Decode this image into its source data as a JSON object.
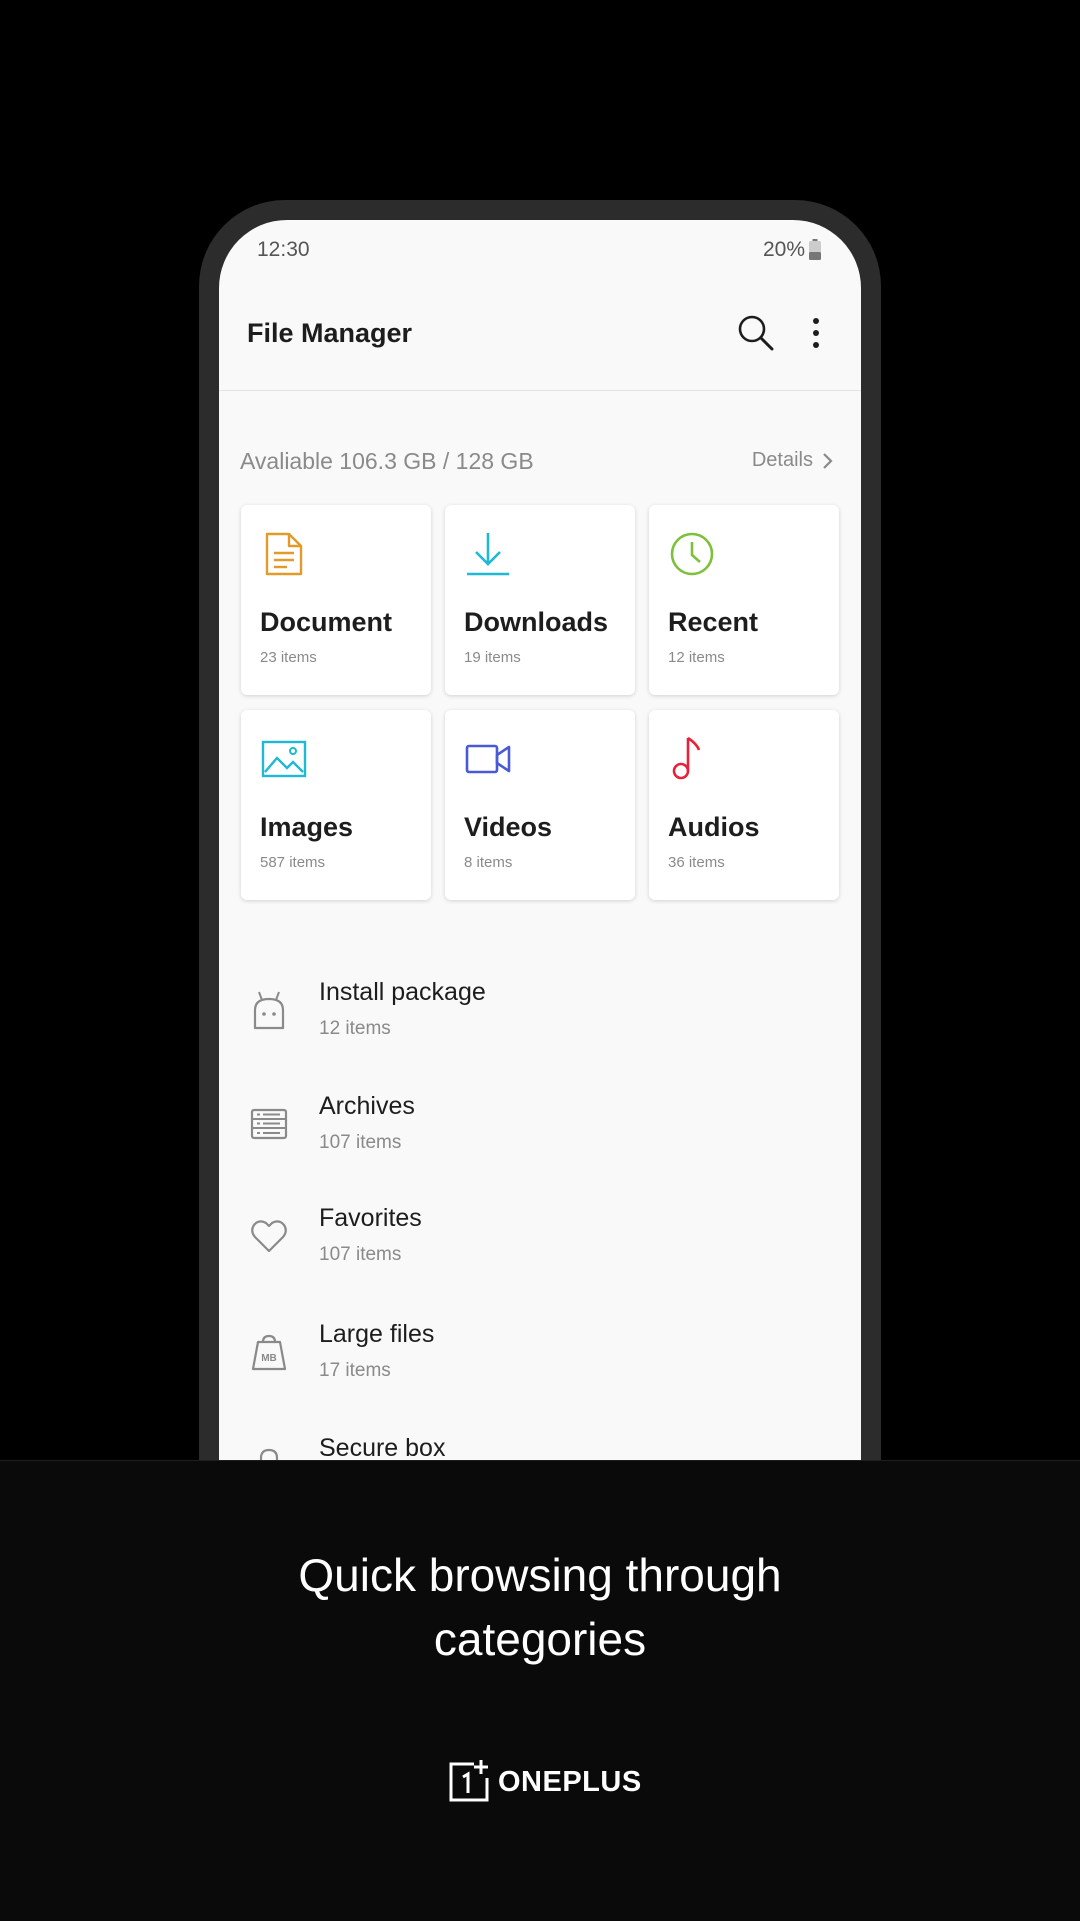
{
  "status_bar": {
    "time": "12:30",
    "battery": "20%"
  },
  "app_bar": {
    "title": "File Manager"
  },
  "storage": {
    "text": "Avaliable 106.3 GB / 128 GB",
    "details_label": "Details"
  },
  "categories": [
    {
      "name": "Document",
      "count": "23 items",
      "icon": "document-icon",
      "color": "#e29a2a"
    },
    {
      "name": "Downloads",
      "count": "19 items",
      "icon": "download-icon",
      "color": "#1fb8d5"
    },
    {
      "name": "Recent",
      "count": "12 items",
      "icon": "clock-icon",
      "color": "#7dc13a"
    },
    {
      "name": "Images",
      "count": "587 items",
      "icon": "image-icon",
      "color": "#1fb8d5"
    },
    {
      "name": "Videos",
      "count": "8 items",
      "icon": "video-icon",
      "color": "#4a5ad6"
    },
    {
      "name": "Audios",
      "count": "36 items",
      "icon": "music-note-icon",
      "color": "#e8203a"
    }
  ],
  "list": [
    {
      "title": "Install package",
      "count": "12 items",
      "icon": "android-icon"
    },
    {
      "title": "Archives",
      "count": "107 items",
      "icon": "archive-icon"
    },
    {
      "title": "Favorites",
      "count": "107 items",
      "icon": "heart-icon"
    },
    {
      "title": "Large files",
      "count": "17 items",
      "icon": "large-file-icon"
    },
    {
      "title": "Secure box",
      "count": "",
      "icon": "lock-icon"
    }
  ],
  "promo": {
    "line1": "Quick browsing through",
    "line2": "categories",
    "brand": "ONEPLUS"
  }
}
